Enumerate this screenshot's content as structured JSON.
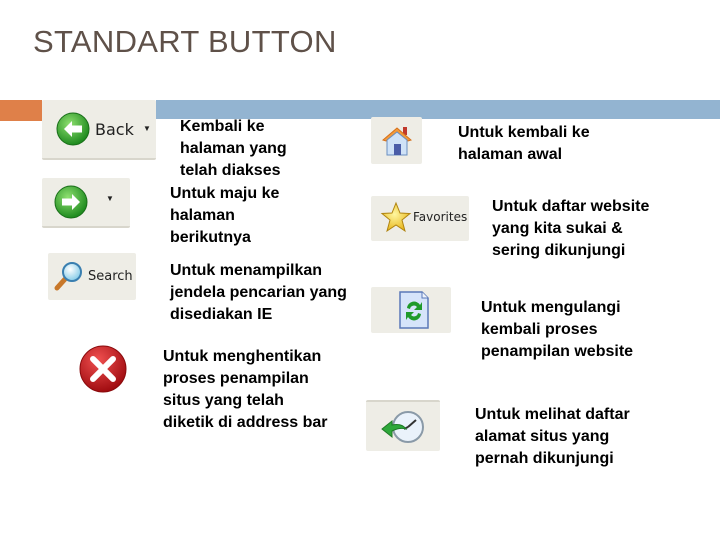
{
  "page": {
    "title": "STANDART BUTTON"
  },
  "colors": {
    "accent_orange": "#df8049",
    "accent_blue": "#93b4d1",
    "title_color": "#5f5149",
    "button_bg": "#eeede6"
  },
  "buttons": [
    {
      "id": "back",
      "icon": "back-arrow-icon",
      "label": "Back",
      "has_dropdown": true,
      "description": "Kembali ke halaman yang telah diakses"
    },
    {
      "id": "forward",
      "icon": "forward-arrow-icon",
      "label": "",
      "has_dropdown": true,
      "description": "Untuk maju ke halaman berikutnya"
    },
    {
      "id": "search",
      "icon": "magnifier-icon",
      "label": "Search",
      "description": "Untuk menampilkan jendela pencarian yang disediakan IE"
    },
    {
      "id": "stop",
      "icon": "stop-x-icon",
      "label": "",
      "description": "Untuk menghentikan proses penampilan situs yang telah diketik di address bar"
    },
    {
      "id": "home",
      "icon": "home-icon",
      "label": "",
      "description": "Untuk kembali ke halaman awal"
    },
    {
      "id": "favorites",
      "icon": "star-icon",
      "label": "Favorites",
      "description": "Untuk daftar website yang kita sukai & sering dikunjungi"
    },
    {
      "id": "refresh",
      "icon": "refresh-icon",
      "label": "",
      "description": "Untuk mengulangi kembali proses penampilan website"
    },
    {
      "id": "history",
      "icon": "history-icon",
      "label": "",
      "description": "Untuk melihat daftar alamat situs yang pernah dikunjungi"
    }
  ]
}
